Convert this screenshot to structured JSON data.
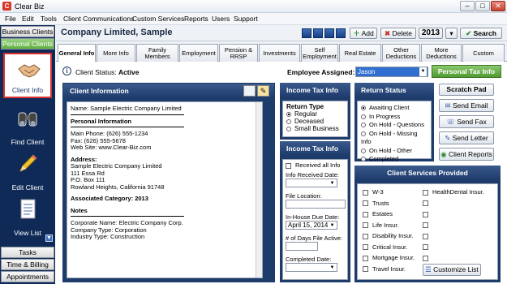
{
  "window": {
    "title": "Clear Biz",
    "minimize": "–",
    "maximize": "□",
    "close": "✕"
  },
  "menu": [
    "File",
    "Edit",
    "Tools",
    "Client Communications",
    "Custom Services",
    "Reports",
    "Users",
    "Support"
  ],
  "sidebar": {
    "top_tabs": [
      "Business Clients",
      "Personal Clients"
    ],
    "items": [
      "Client Info",
      "Find Client",
      "Edit Client",
      "View List"
    ],
    "bottom_tabs": [
      "Tasks",
      "Time & Billing",
      "Appointments"
    ]
  },
  "header": {
    "company": "Company Limited, Sample",
    "add": "Add",
    "delete": "Delete",
    "year": "2013",
    "search": "Search"
  },
  "tabs": [
    "General Info",
    "More Info",
    "Family Members",
    "Employment",
    "Pension & RRSP",
    "Investments",
    "Self Employment",
    "Real Estate",
    "Other Deductions",
    "More Deductions",
    "Custom"
  ],
  "status": {
    "label": "Client Status:",
    "value": "Active",
    "employee_label": "Employee Assigned:",
    "employee_value": "Jason",
    "personal_tax_button": "Personal Tax Info"
  },
  "client_info": {
    "title": "Client Information",
    "name_line": "Name: Sample Electric Company Limited",
    "personal_header": "Personal Information",
    "main_phone": "Main Phone:  (626) 555-1234",
    "fax": "Fax:  (626) 555-5678",
    "web": "Web Site:  www.Clear-Biz.com",
    "address_header": "Address:",
    "address_lines": [
      "Sample Electric Company Limited",
      "111 Essa Rd",
      "P.O. Box 111",
      "Rowland Heights, California  91748"
    ],
    "associated": "Associated Category: 2013",
    "notes_header": "Notes",
    "notes_lines": [
      "Corporate Name: Electric Company Corp.",
      "Company Type: Corporation",
      "Industry Type: Construction"
    ]
  },
  "income_tax_info": {
    "title": "Income Tax Info",
    "return_type_label": "Return Type",
    "return_types": [
      "Regular",
      "Deceased",
      "Small Business"
    ],
    "selected_return_type": "Regular"
  },
  "income_tax_info2": {
    "title": "Income Tax Info",
    "received_all": "Received all Info",
    "info_received_date": "Info Received Date:",
    "file_location": "File Location:",
    "inhouse_due_date": "In-House Due Date:",
    "inhouse_due_value": "April 15, 2014",
    "days_active": "# of Days File Active:",
    "completed_date": "Completed Date:"
  },
  "return_status": {
    "title": "Return Status",
    "options": [
      "Awaiting Client",
      "In Progress",
      "On Hold - Questions",
      "On Hold - Missing Info",
      "On Hold - Other",
      "Completed"
    ],
    "selected": "Awaiting Client"
  },
  "actions": [
    "Scratch Pad",
    "Send Email",
    "Send Fax",
    "Send Letter",
    "Client Reports"
  ],
  "client_services": {
    "title": "Client Services Provided",
    "left": [
      "W-3",
      "Trusts",
      "Estates",
      "Life Insur.",
      "Disability Insur.",
      "Critical Insur.",
      "Mortgage Insur.",
      "Travel Insur."
    ],
    "right": [
      "HealthDental Insur.",
      "",
      "",
      "",
      "",
      "",
      ""
    ],
    "customize": "Customize List"
  },
  "colors": {
    "sidebar": "#0f2a57",
    "accent_green": "#5fae3f",
    "panel_head": "#1d3b6b"
  }
}
